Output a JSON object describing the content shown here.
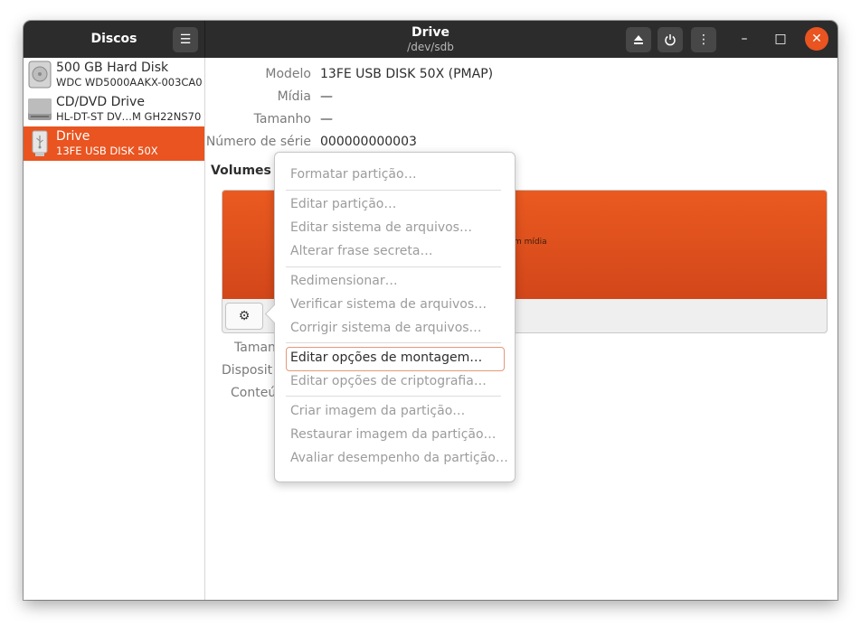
{
  "sidebar_header": {
    "title": "Discos",
    "menu_icon": "hamburger-icon"
  },
  "headerbar": {
    "title": "Drive",
    "subtitle": "/dev/sdb",
    "eject_icon": "eject-icon",
    "power_icon": "power-icon",
    "more_icon": "vertical-dots-icon",
    "minimize_icon": "minimize-icon",
    "maximize_icon": "maximize-icon",
    "close_icon": "close-icon"
  },
  "disks": [
    {
      "name": "500 GB Hard Disk",
      "model": "WDC WD5000AAKX-003CA0",
      "icon": "hard-disk-icon",
      "selected": false
    },
    {
      "name": "CD/DVD Drive",
      "model": "HL-DT-ST DV…M GH22NS70",
      "icon": "optical-drive-icon",
      "selected": false
    },
    {
      "name": "Drive",
      "model": "13FE USB DISK 50X",
      "icon": "usb-drive-icon",
      "selected": true
    }
  ],
  "drive_properties": [
    {
      "label": "Modelo",
      "value": "13FE USB DISK 50X (PMAP)"
    },
    {
      "label": "Mídia",
      "value": "—"
    },
    {
      "label": "Tamanho",
      "value": "—"
    },
    {
      "label": "Número de série",
      "value": "000000000003"
    }
  ],
  "volumes": {
    "title": "Volumes",
    "partition_text": "m mídia",
    "gear_icon": "gear-icon",
    "lower_labels": [
      "Taman",
      "Disposit",
      "Conteú"
    ]
  },
  "partition_menu": {
    "groups": [
      [
        "Formatar partição…"
      ],
      [
        "Editar partição…",
        "Editar sistema de arquivos…",
        "Alterar frase secreta…"
      ],
      [
        "Redimensionar…",
        "Verificar sistema de arquivos…",
        "Corrigir sistema de arquivos…"
      ],
      [
        "Editar opções de montagem…",
        "Editar opções de criptografia…"
      ],
      [
        "Criar imagem da partição…",
        "Restaurar imagem da partição…",
        "Avaliar desempenho da partição…"
      ]
    ],
    "active_item": "Editar opções de montagem…"
  },
  "colors": {
    "accent": "#e95420",
    "headerbar": "#2c2c2c"
  }
}
